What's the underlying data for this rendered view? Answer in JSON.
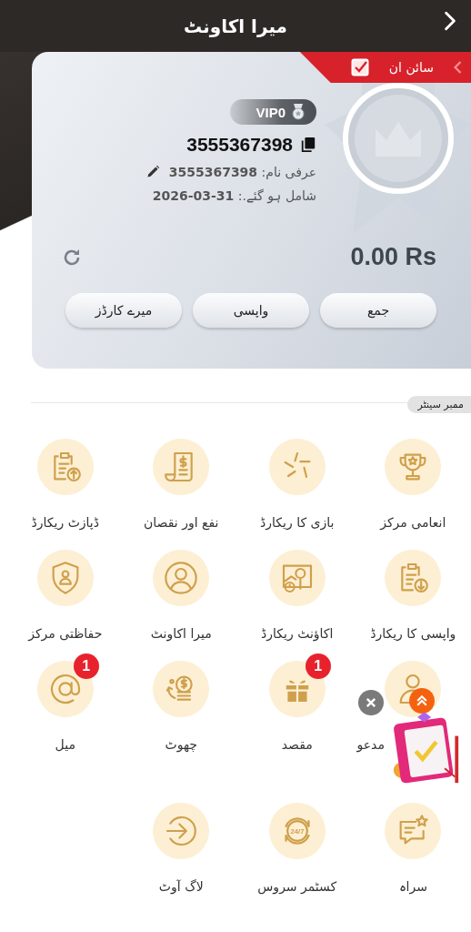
{
  "header": {
    "title": "میرا اکاونٹ"
  },
  "profile": {
    "sign_in": "سائن ان",
    "vip": "VIP0",
    "user_id": "3555367398",
    "nickname": "عرفی نام: **3555367398**",
    "joined": "شامل ہو گئے.: **2026-03-31**",
    "balance": "0.00 Rs"
  },
  "actions": [
    "جمع",
    "واپسی",
    "میرے کارڈز"
  ],
  "member_center": {
    "title": "ممبر سینٹر",
    "items": [
      {
        "label": "انعامی مرکز"
      },
      {
        "label": "بازی کا ریکارڈ"
      },
      {
        "label": "نفع اور نقصان"
      },
      {
        "label": "ڈپازٹ ریکارڈ"
      },
      {
        "label": "واپسی کا ریکارڈ"
      },
      {
        "label": "اکاؤنٹ ریکارڈ"
      },
      {
        "label": "میرا اکاونٹ"
      },
      {
        "label": "حفاظتی مرکز"
      },
      {
        "label": "مدعو"
      },
      {
        "label": "مقصد",
        "badge": "1"
      },
      {
        "label": "چھوٹ"
      },
      {
        "label": "میل",
        "badge": "1"
      },
      {
        "label": "سراہ"
      },
      {
        "label": "کسٹمر سروس",
        "icon_text": "24/7"
      },
      {
        "label": "لاگ آوٹ"
      }
    ]
  }
}
